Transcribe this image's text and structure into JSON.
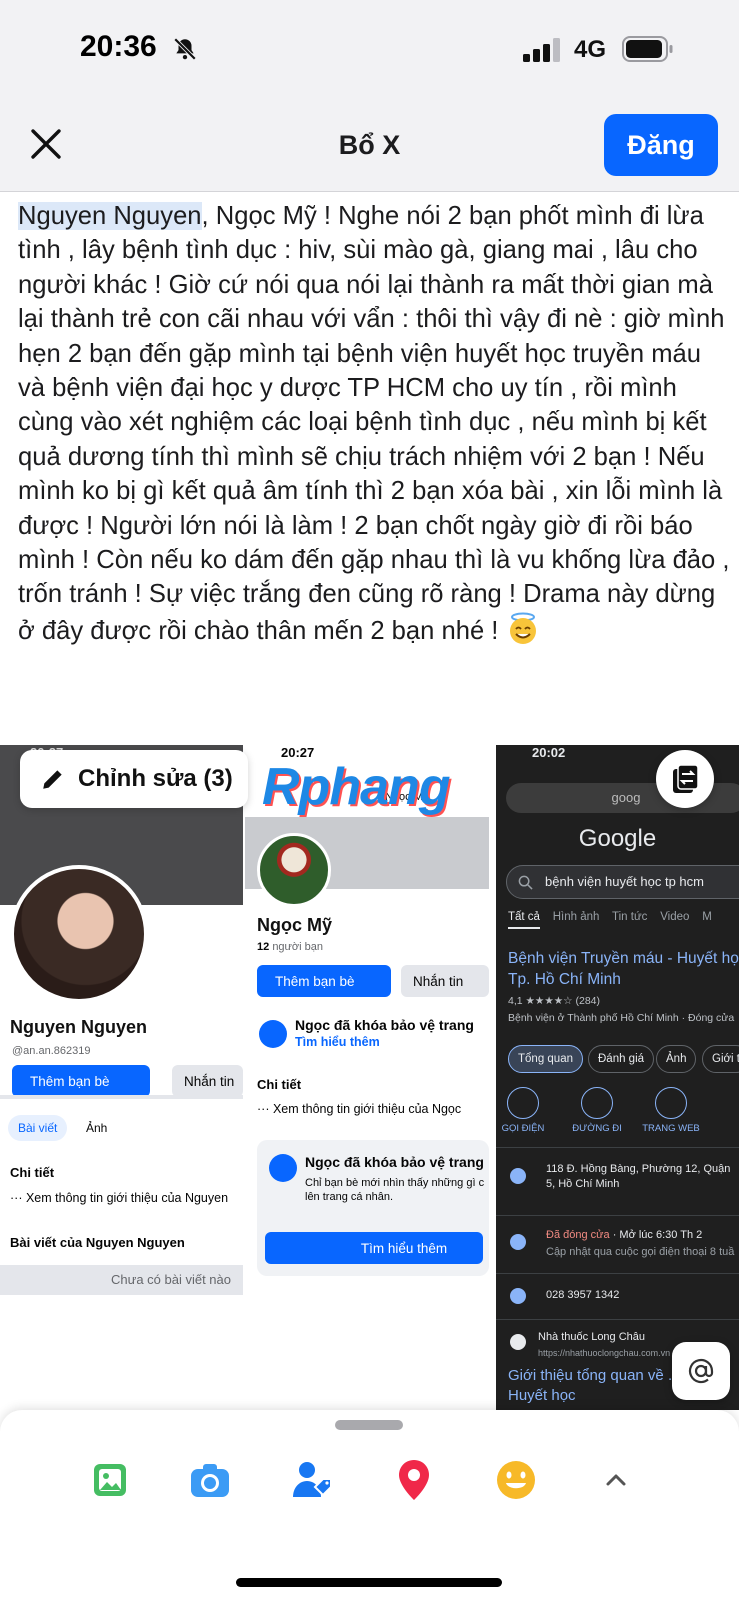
{
  "status_bar": {
    "time": "20:36",
    "network": "4G"
  },
  "header": {
    "title": "Bổ X",
    "post_label": "Đăng"
  },
  "post": {
    "mention": "Nguyen Nguyen",
    "body": ", Ngọc Mỹ ! Nghe nói 2 bạn phốt mình đi lừa tình , lây bệnh tình dục : hiv, sùi mào gà, giang mai , lâu cho người khác ! Giờ cứ nói qua nói lại thành ra mất thời gian mà lại thành trẻ con cãi nhau với vẩn : thôi thì vậy đi nè : giờ mình hẹn 2 bạn đến gặp mình tại bệnh viện huyết học truyền máu và bệnh viện đại học y dược TP HCM cho uy tín , rồi mình cùng vào xét nghiệm các loại bệnh tình dục , nếu mình bị kết quả dương tính thì mình sẽ chịu trách nhiệm với 2 bạn ! Nếu mình ko bị gì kết quả âm tính thì 2 bạn xóa bài , xin lỗi mình là được ! Người lớn nói là làm ! 2 bạn chốt ngày giờ đi rồi báo mình ! Còn nếu ko dám đến gặp nhau thì là vu khống lừa đảo , trốn tránh ! Sự việc trắng đen cũng rõ ràng ! Drama này dừng ở đây được rồi chào thân mến 2 bạn nhé ! "
  },
  "edit_button": {
    "label": "Chỉnh sửa (3)"
  },
  "shot1": {
    "time": "20:27",
    "name": "Nguyen Nguyen",
    "handle": "@an.an.862319",
    "add_friend": "Thêm bạn bè",
    "message": "Nhắn tin",
    "tab_posts": "Bài viết",
    "tab_photos": "Ảnh",
    "details_title": "Chi tiết",
    "details_link": "Xem thông tin giới thiệu của Nguyen",
    "posts_title": "Bài viết của Nguyen Nguyen",
    "no_posts": "Chưa có bài viết nào"
  },
  "shot2": {
    "time": "20:27",
    "watermark": "Rphang",
    "header_name": "Ngọc Mỹ",
    "name": "Ngọc Mỹ",
    "friends_count": "12",
    "friends_label": "người bạn",
    "add_friend": "Thêm bạn bè",
    "message": "Nhắn tin",
    "locked_title": "Ngọc đã khóa bảo vệ trang",
    "learn_more_link": "Tìm hiểu thêm",
    "details_title": "Chi tiết",
    "details_link": "Xem thông tin giới thiệu của Ngọc",
    "card_title": "Ngọc đã khóa bảo vệ trang",
    "card_body": "Chỉ bạn bè mới nhìn thấy những gì c lên trang cá nhân.",
    "card_button": "Tìm hiểu thêm"
  },
  "shot3": {
    "time": "20:02",
    "search_bar": "goog",
    "google": "Google",
    "query": "bệnh viện huyết học tp hcm",
    "tabs": [
      "Tất cả",
      "Hình ảnh",
      "Tin tức",
      "Video",
      "M"
    ],
    "result_title": "Bệnh viện Truyền máu - Huyết học Tp. Hồ Chí Minh",
    "rating": "4,1 ★★★★☆ (284)",
    "category": "Bệnh viện ở Thành phố Hồ Chí Minh · Đóng cửa",
    "chips": [
      "Tổng quan",
      "Đánh giá",
      "Ảnh",
      "Giới t"
    ],
    "actions": [
      "GỌI ĐIỆN",
      "ĐƯỜNG ĐI",
      "TRANG WEB"
    ],
    "address": "118 Đ. Hồng Bàng, Phường 12, Quận 5, Hồ Chí Minh",
    "hours_status": "Đã đóng cửa",
    "hours_open": " · Mở lúc 6:30 Th 2",
    "hours_note": "Cập nhật qua cuộc gọi điện thoại 8 tuầ",
    "phone": "028 3957 1342",
    "site_name": "Nhà thuốc Long Châu",
    "site_url": "https://nhathuoclongchau.com.vn",
    "snippet": "Giới thiệu tổng quan về ... máu Huyết học"
  },
  "toolbar_icons": [
    "photo-icon",
    "camera-icon",
    "tag-people-icon",
    "location-pin-icon",
    "emoji-icon",
    "chevron-up-icon"
  ],
  "colors": {
    "primary": "#0866ff",
    "photo_green": "#45bd62",
    "camera_blue": "#3b9bf5",
    "tag_blue": "#1877f2",
    "pin_red": "#f02849",
    "emoji_yellow": "#f7b928"
  }
}
